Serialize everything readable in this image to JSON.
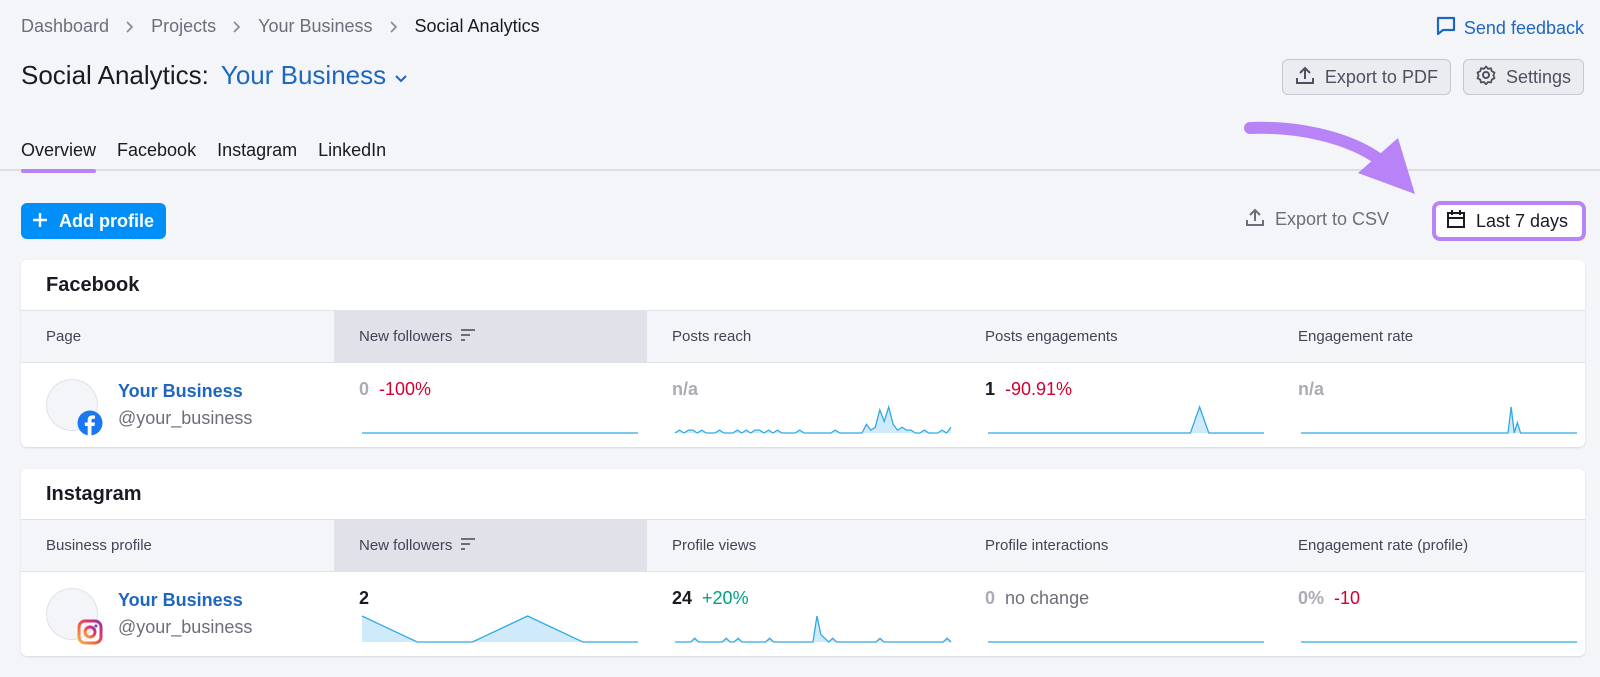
{
  "breadcrumb": [
    {
      "label": "Dashboard"
    },
    {
      "label": "Projects"
    },
    {
      "label": "Your Business"
    },
    {
      "label": "Social Analytics"
    }
  ],
  "feedback_label": "Send feedback",
  "title": {
    "label": "Social Analytics:",
    "project": "Your Business"
  },
  "top_actions": {
    "export_pdf": "Export to PDF",
    "settings": "Settings"
  },
  "tabs": [
    {
      "label": "Overview",
      "active": true
    },
    {
      "label": "Facebook"
    },
    {
      "label": "Instagram"
    },
    {
      "label": "LinkedIn"
    }
  ],
  "toolbar": {
    "add_profile": "Add profile",
    "export_csv": "Export to CSV",
    "date_range": "Last 7 days"
  },
  "colors": {
    "accent": "#b983f8",
    "link": "#1d67c2",
    "primary": "#008ff8",
    "spark": "#32a8e6",
    "negative": "#d1002f",
    "positive": "#009f81"
  },
  "facebook": {
    "title": "Facebook",
    "headers": [
      "Page",
      "New followers",
      "Posts reach",
      "Posts engagements",
      "Engagement rate"
    ],
    "row": {
      "name": "Your Business",
      "handle": "@your_business",
      "metrics": [
        {
          "value": "0",
          "change": "-100%",
          "trend": "neg",
          "muted": true,
          "series": [
            0,
            0,
            0,
            0,
            0,
            0,
            0,
            0
          ]
        },
        {
          "value": "n/a",
          "change": "",
          "trend": "",
          "muted": true,
          "series": [
            0,
            1,
            0,
            1,
            1,
            0,
            1,
            0,
            0,
            0,
            1,
            0,
            0,
            0,
            1,
            0,
            1,
            0,
            1,
            1,
            0,
            1,
            0,
            1,
            0,
            0,
            0,
            0,
            1,
            0,
            0,
            0,
            0,
            0,
            0,
            0,
            1,
            0,
            0,
            0,
            0,
            0,
            0,
            3,
            1,
            2,
            8,
            4,
            9,
            3,
            1,
            2,
            1,
            1,
            0,
            0,
            1,
            0,
            0,
            0,
            1,
            0,
            2
          ]
        },
        {
          "value": "1",
          "change": "-90.91%",
          "trend": "neg",
          "muted": false,
          "series": [
            0,
            0,
            0,
            0,
            0,
            0,
            0,
            0,
            0,
            0,
            0,
            0,
            0,
            0,
            0,
            0,
            0,
            0,
            0,
            0,
            0,
            0,
            0,
            10,
            0,
            0,
            0,
            0,
            0,
            0,
            0
          ]
        },
        {
          "value": "n/a",
          "change": "",
          "trend": "",
          "muted": true,
          "series": [
            0,
            0,
            0,
            0,
            0,
            0,
            0,
            0,
            0,
            0,
            0,
            0,
            0,
            0,
            0,
            0,
            0,
            0,
            0,
            0,
            0,
            0,
            0,
            0,
            0,
            0,
            0,
            0,
            0,
            0,
            0,
            0,
            0,
            0,
            0,
            0,
            0,
            0,
            0,
            0,
            0,
            0,
            0,
            0,
            0,
            0,
            0,
            0,
            0,
            0,
            0,
            0,
            0,
            0,
            0,
            0,
            0,
            0,
            0,
            0,
            0,
            0,
            0,
            0,
            0,
            0,
            0,
            10,
            0,
            4,
            0,
            0,
            0,
            0,
            0,
            0,
            0,
            0,
            0,
            0,
            0,
            0,
            0,
            0,
            0,
            0,
            0,
            0,
            0
          ]
        }
      ]
    }
  },
  "instagram": {
    "title": "Instagram",
    "headers": [
      "Business profile",
      "New followers",
      "Profile views",
      "Profile interactions",
      "Engagement rate (profile)"
    ],
    "row": {
      "name": "Your Business",
      "handle": "@your_business",
      "metrics": [
        {
          "value": "2",
          "change": "",
          "trend": "",
          "muted": false,
          "series": [
            1,
            0,
            0,
            1,
            0,
            0
          ]
        },
        {
          "value": "24",
          "change": "+20%",
          "trend": "pos",
          "muted": false,
          "series": [
            0,
            0,
            0,
            0,
            0,
            1,
            0,
            0,
            0,
            0,
            0,
            0,
            0,
            1,
            0,
            0,
            1,
            0,
            0,
            0,
            0,
            0,
            0,
            0,
            1,
            0,
            0,
            0,
            0,
            0,
            0,
            0,
            0,
            0,
            0,
            0,
            7,
            2,
            1,
            0,
            1,
            0,
            0,
            0,
            0,
            0,
            0,
            0,
            0,
            0,
            0,
            0,
            1,
            0,
            0,
            0,
            0,
            0,
            0,
            0,
            0,
            0,
            0,
            0,
            0,
            0,
            0,
            0,
            0,
            1,
            0
          ]
        },
        {
          "value": "0",
          "change": "no change",
          "trend": "neutral",
          "muted": true,
          "series": [
            0,
            0,
            0,
            0,
            0,
            0
          ]
        },
        {
          "value": "0%",
          "change": "-10",
          "trend": "neg",
          "muted": true,
          "series": [
            0,
            0,
            0,
            0,
            0,
            0
          ]
        }
      ]
    }
  }
}
